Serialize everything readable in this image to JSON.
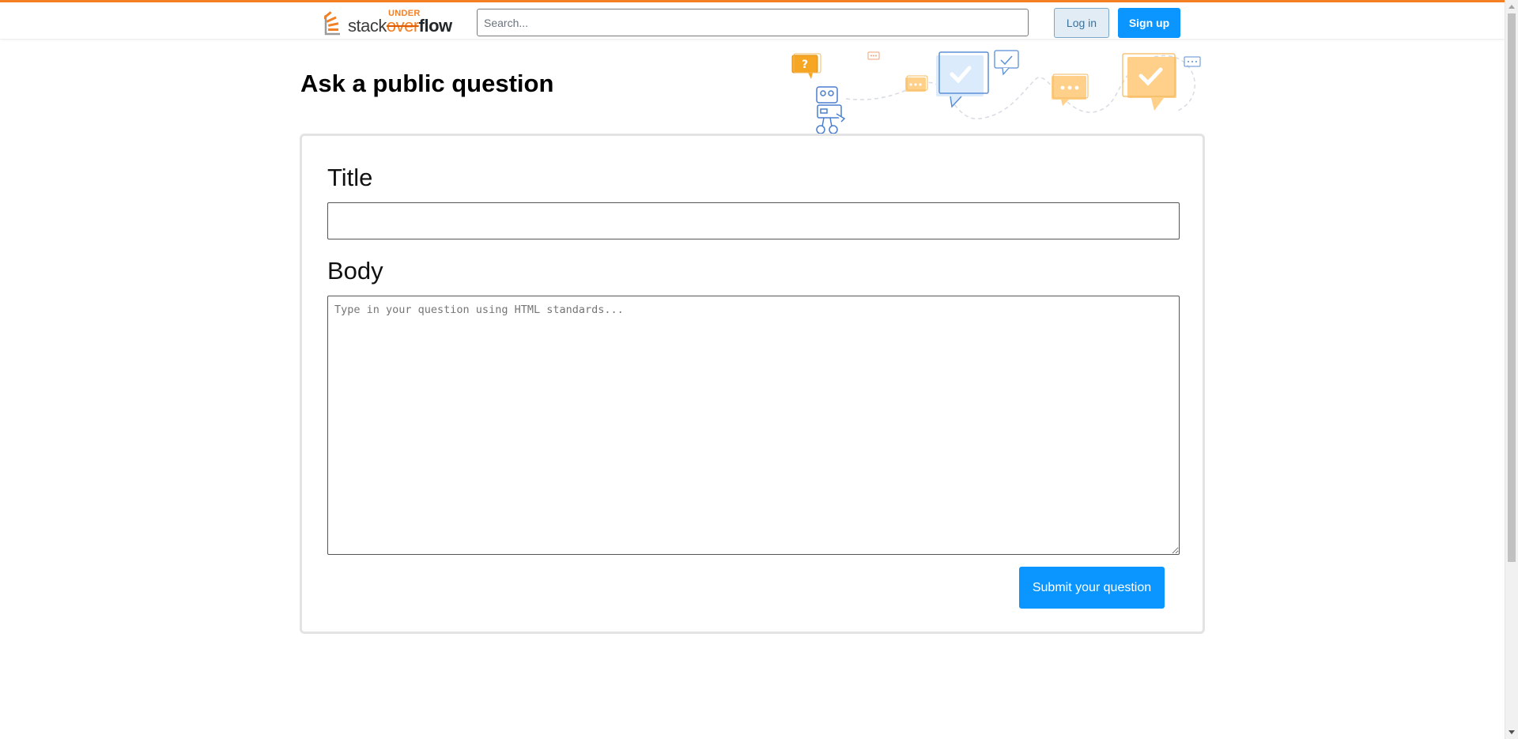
{
  "brand": {
    "word_regular": "stack",
    "word_struck": "over",
    "word_bold": "flow",
    "word_above": "UNDER",
    "accent_color": "#f48024"
  },
  "header": {
    "search_placeholder": "Search...",
    "login_label": "Log in",
    "signup_label": "Sign up"
  },
  "page": {
    "title": "Ask a public question"
  },
  "form": {
    "title_label": "Title",
    "title_value": "",
    "body_label": "Body",
    "body_placeholder": "Type in your question using HTML standards...",
    "body_value": "",
    "submit_label": "Submit your question"
  },
  "colors": {
    "primary_blue": "#0a95ff",
    "login_bg": "#e1ecf4",
    "login_text": "#39739d",
    "illustration_orange": "#ffd08a",
    "illustration_blue": "#5b8fd6"
  },
  "icons": {
    "logo": "stack-logo-icon",
    "illustration": "robot-chat-illustration"
  }
}
